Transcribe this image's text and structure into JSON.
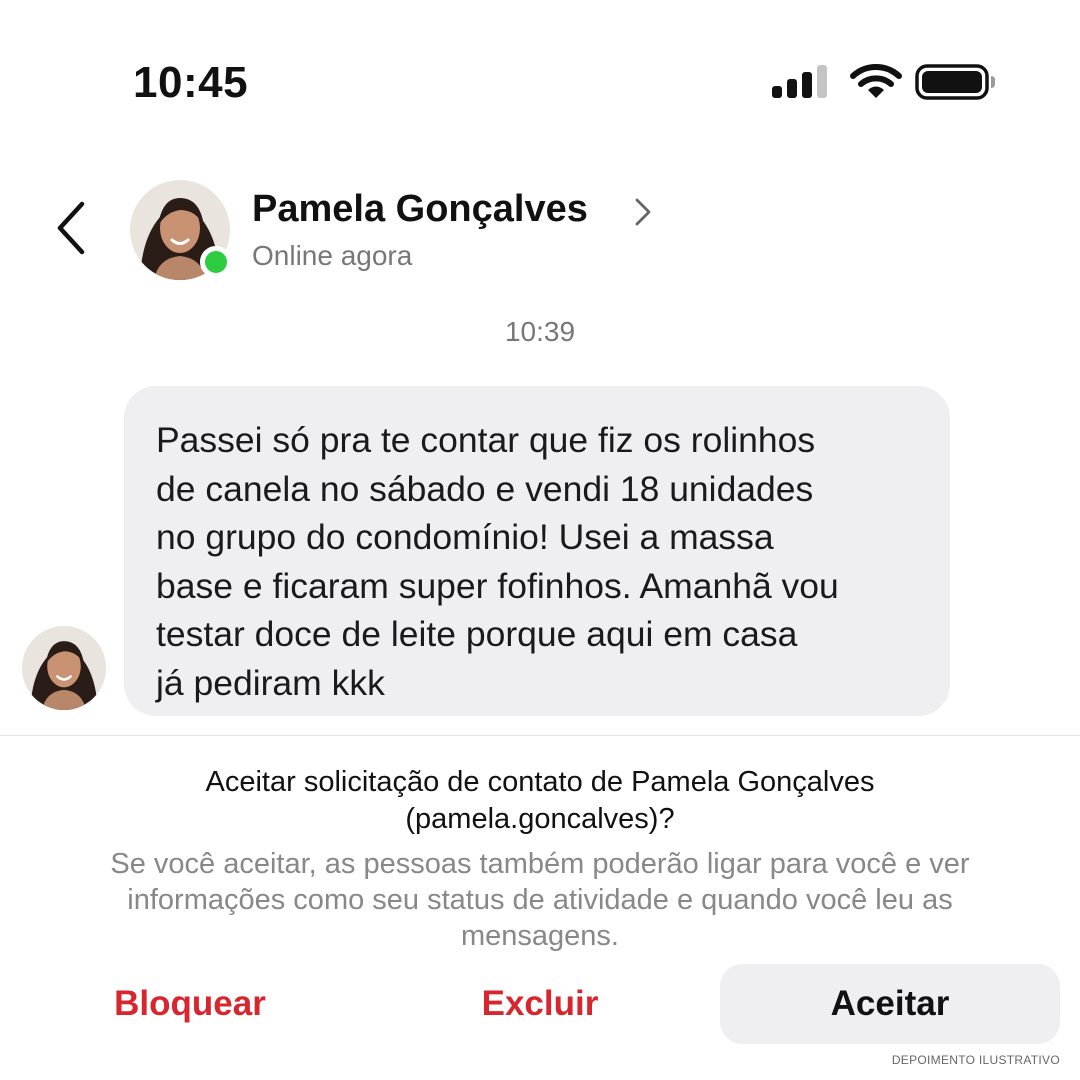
{
  "status_bar": {
    "time": "10:45",
    "signal_icon": "cellular-signal-icon",
    "wifi_icon": "wifi-icon",
    "battery_icon": "battery-icon"
  },
  "header": {
    "back_icon": "chevron-left-icon",
    "contact_name": "Pamela Gonçalves",
    "contact_status": "Online agora",
    "online_indicator_color": "#2ecc40"
  },
  "conversation": {
    "timestamp": "10:39",
    "messages": [
      {
        "from": "Pamela Gonçalves",
        "text": "Passei só pra te contar que fiz os rolinhos\nde canela no sábado e vendi 18 unidades\nno grupo do condomínio! Usei a massa\nbase e ficaram super fofinhos. Amanhã vou\ntestar doce de leite porque aqui em casa\njá pediram kkk"
      }
    ]
  },
  "request": {
    "title": "Aceitar solicitação de contato de Pamela Gonçalves\n(pamela.goncalves)?",
    "description": "Se você aceitar, as pessoas também poderão ligar para você e ver\ninformações como seu status de atividade e quando você leu as\nmensagens.",
    "block_label": "Bloquear",
    "delete_label": "Excluir",
    "accept_label": "Aceitar"
  },
  "colors": {
    "destructive": "#d7262e",
    "bubble_bg": "#efeff1",
    "online": "#2ecc40"
  },
  "disclaimer": "DEPOIMENTO ILUSTRATIVO"
}
